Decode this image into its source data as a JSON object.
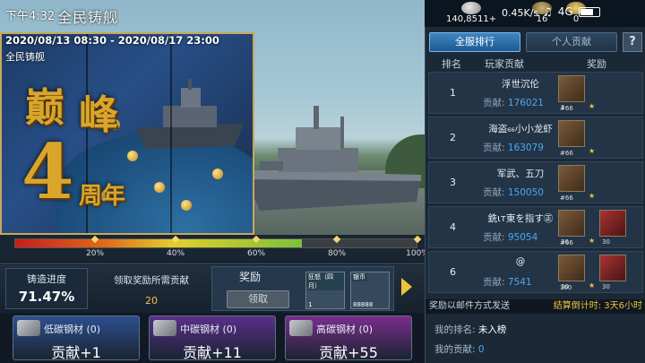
{
  "status": {
    "time": "下午4:32",
    "network_speed": "0.45K/s",
    "signal": "4G"
  },
  "page": {
    "title": "全民铸舰"
  },
  "resources": [
    {
      "icon": "silver-coin-icon",
      "value": "140,8511+"
    },
    {
      "icon": "gear-icon",
      "value": "16"
    },
    {
      "icon": "medal-icon",
      "value": "0"
    }
  ],
  "poster": {
    "date_range": "2020/08/13 08:30 - 2020/08/17 23:00",
    "event_name": "全民铸舰",
    "headline_1": "巅",
    "headline_2": "峰",
    "headline_3": "4",
    "headline_4": "周年"
  },
  "progress": {
    "value": 0.7147,
    "ticks": [
      "20%",
      "40%",
      "60%",
      "80%",
      "100%"
    ],
    "label": "铸造进度",
    "value_text": "71.47%"
  },
  "claim": {
    "need_label": "领取奖励所需贡献",
    "need_value": "20",
    "reward_label": "奖励",
    "claim_button": "领取",
    "items": [
      {
        "tag": "狂怒（四月）",
        "count": "1"
      },
      {
        "tag": "银币",
        "count": "88888"
      }
    ]
  },
  "materials": [
    {
      "name": "低碳钢材",
      "qty": "(0)",
      "gain": "贡献+1",
      "color": "#2d4f8f"
    },
    {
      "name": "中碳钢材",
      "qty": "(0)",
      "gain": "贡献+11",
      "color": "#5a2f8a"
    },
    {
      "name": "高碳钢材",
      "qty": "(0)",
      "gain": "贡献+55",
      "color": "#7a2d8c"
    }
  ],
  "rank_panel": {
    "tab_all": "全服排行",
    "tab_mine": "个人贡献",
    "help": "?",
    "col_rank": "排名",
    "col_player": "玩家贡献",
    "col_reward": "奖励",
    "contrib_label": "贡献:",
    "rows": [
      {
        "rank": "1",
        "name": "浮世沉伦",
        "score": "176021",
        "reward_tag": "大型战舰宝箱",
        "reward_count": "1",
        "level": "#66"
      },
      {
        "rank": "2",
        "name": "海盗₆₆小小龙虾",
        "score": "163079",
        "reward_tag": "",
        "reward_count": "",
        "level": "#66"
      },
      {
        "rank": "3",
        "name": "军武、五刀",
        "score": "150050",
        "reward_tag": "",
        "reward_count": "",
        "level": "#66"
      },
      {
        "rank": "4",
        "name": "銑ι⁣т東を指す㊣",
        "score": "95054",
        "reward_tag": "晋升报告",
        "reward_count": "30",
        "level": "#66"
      },
      {
        "rank": "6",
        "name": "@",
        "score": "7541",
        "reward_tag": "战争与和平",
        "reward_count": "30",
        "level": "300"
      }
    ],
    "mail_note": "奖励以邮件方式发送",
    "countdown": "结算倒计时: 3天6小时",
    "my_rank_label": "我的排名:",
    "my_rank_value": "未入榜",
    "my_contrib_label": "我的贡献:",
    "my_contrib_value": "0"
  }
}
